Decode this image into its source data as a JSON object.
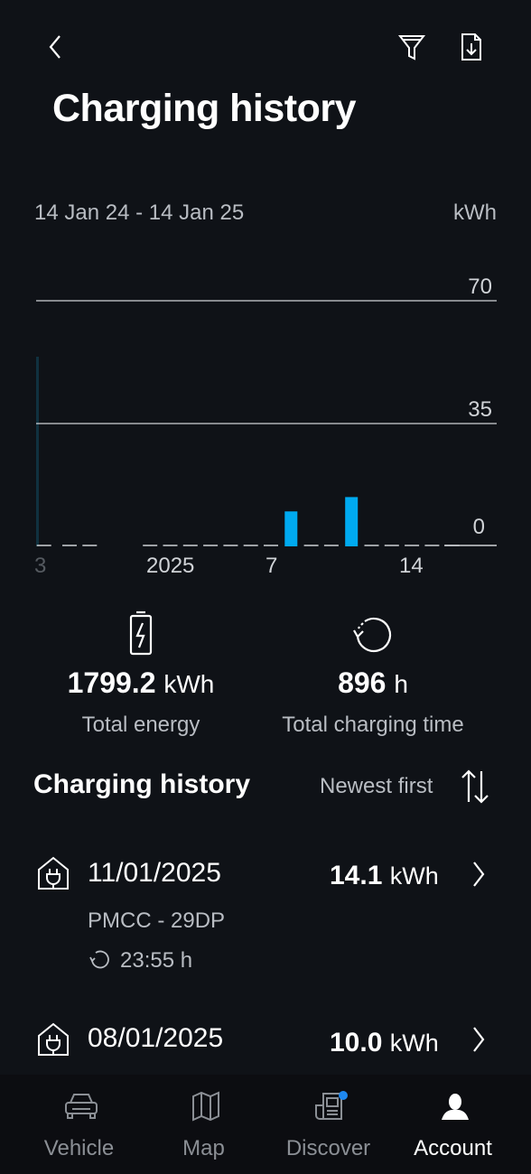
{
  "header": {
    "title": "Charging history",
    "back_icon": "chevron-left-icon",
    "filter_icon": "filter-icon",
    "export_icon": "document-download-icon"
  },
  "chart_data": {
    "type": "bar",
    "date_range": "14 Jan 24 - 14 Jan 25",
    "unit": "kWh",
    "x_tick_labels": [
      "3",
      "2025",
      "7",
      "14"
    ],
    "y_tick_labels": [
      "70",
      "35",
      "0"
    ],
    "ylim": [
      0,
      70
    ],
    "grid": true,
    "bar_color": "#00aaf0",
    "categories": [
      "8 Jan 2025",
      "11 Jan 2025"
    ],
    "values": [
      10.0,
      14.1
    ]
  },
  "stats": {
    "energy_value": "1799.2",
    "energy_unit": "kWh",
    "energy_label": "Total energy",
    "time_value": "896",
    "time_unit": "h",
    "time_label": "Total charging time"
  },
  "history": {
    "title": "Charging history",
    "sort_label": "Newest first",
    "entries": [
      {
        "date": "11/01/2025",
        "energy": "14.1",
        "unit": "kWh",
        "location": "PMCC - 29DP",
        "duration": "23:55 h"
      },
      {
        "date": "08/01/2025",
        "energy": "10.0",
        "unit": "kWh"
      }
    ]
  },
  "nav": {
    "items": [
      {
        "label": "Vehicle",
        "icon": "car-icon",
        "active": false
      },
      {
        "label": "Map",
        "icon": "map-icon",
        "active": false
      },
      {
        "label": "Discover",
        "icon": "news-icon",
        "active": false,
        "badge": true
      },
      {
        "label": "Account",
        "icon": "person-icon",
        "active": true
      }
    ],
    "badge_color": "#1e88f0"
  }
}
